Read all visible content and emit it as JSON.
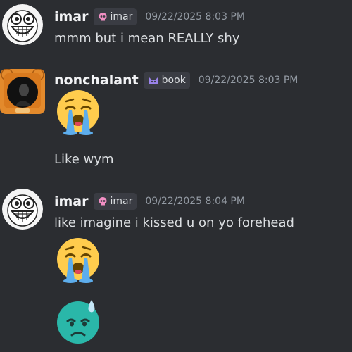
{
  "colors": {
    "background": "#2b2d31",
    "text": "#dbdee1",
    "username": "#f2f3f5",
    "timestamp": "#949ba4",
    "tag_background": "#3a3c43"
  },
  "messages": [
    {
      "username": "imar",
      "tag_icon": "pink-skull-icon",
      "tag_label": "imar",
      "timestamp": "09/22/2025 8:03 PM",
      "text": "mmm but i mean REALLY shy",
      "avatar": "laughing-meme-face-avatar"
    },
    {
      "username": "nonchalant",
      "tag_icon": "purple-cat-icon",
      "tag_label": "book",
      "timestamp": "09/22/2025 8:03 PM",
      "emoji": "loudly-crying-face-icon",
      "text": "Like wym",
      "avatar": "tiger-frame-avatar"
    },
    {
      "username": "imar",
      "tag_icon": "pink-skull-icon",
      "tag_label": "imar",
      "timestamp": "09/22/2025 8:04 PM",
      "text": "like imagine i kissed u on yo forehead",
      "emojis": [
        "loudly-crying-face-icon",
        "sweat-sad-face-icon"
      ],
      "avatar": "laughing-meme-face-avatar"
    }
  ]
}
